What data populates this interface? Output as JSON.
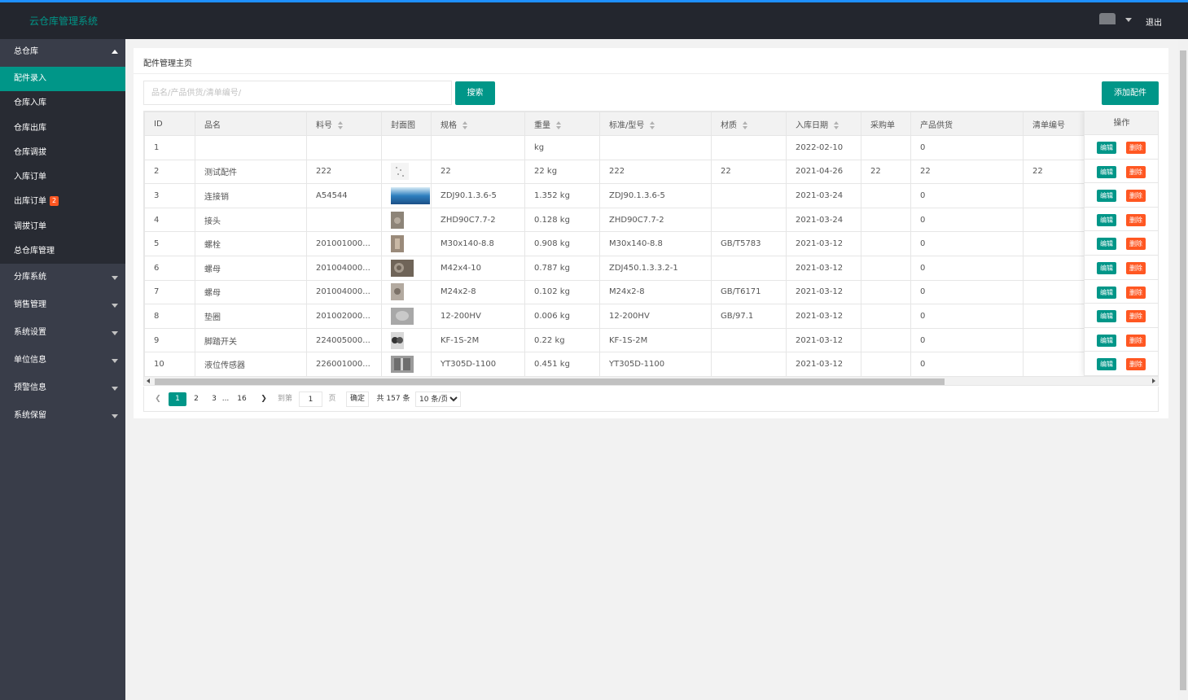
{
  "header": {
    "app_title": "云仓库管理系统",
    "logout_label": "退出"
  },
  "sidebar": {
    "main_group": "总仓库",
    "sub_items": [
      {
        "label": "配件录入",
        "active": true
      },
      {
        "label": "仓库入库"
      },
      {
        "label": "仓库出库"
      },
      {
        "label": "仓库调拔"
      },
      {
        "label": "入库订单"
      },
      {
        "label": "出库订单",
        "badge": "2"
      },
      {
        "label": "调拔订单"
      },
      {
        "label": "总仓库管理"
      }
    ],
    "groups": [
      "分库系统",
      "销售管理",
      "系统设置",
      "单位信息",
      "预警信息",
      "系统保留"
    ]
  },
  "page": {
    "breadcrumb": "配件管理主页",
    "search_placeholder": "品名/产品供货/清单编号/",
    "search_label": "搜索",
    "add_label": "添加配件"
  },
  "table": {
    "columns": [
      "ID",
      "品名",
      "料号",
      "封面图",
      "规格",
      "重量",
      "标准/型号",
      "材质",
      "入库日期",
      "采购单",
      "产品供货",
      "清单编号"
    ],
    "actions_header": "操作",
    "edit_label": "编辑",
    "delete_label": "删除",
    "rows": [
      {
        "id": "1",
        "name": "",
        "part_no": "",
        "spec": "",
        "weight": "kg",
        "standard": "",
        "material": "",
        "date": "2022-02-10",
        "purchase": "",
        "supply": "0",
        "list_no": ""
      },
      {
        "id": "2",
        "name": "测试配件",
        "part_no": "222",
        "spec": "22",
        "weight": "22 kg",
        "standard": "222",
        "material": "22",
        "date": "2021-04-26",
        "purchase": "22",
        "supply": "22",
        "list_no": "22"
      },
      {
        "id": "3",
        "name": "连接销",
        "part_no": "A54544",
        "spec": "ZDJ90.1.3.6-5",
        "weight": "1.352 kg",
        "standard": "ZDJ90.1.3.6-5",
        "material": "",
        "date": "2021-03-24",
        "purchase": "",
        "supply": "0",
        "list_no": ""
      },
      {
        "id": "4",
        "name": "接头",
        "part_no": "",
        "spec": "ZHD90C7.7-2",
        "weight": "0.128 kg",
        "standard": "ZHD90C7.7-2",
        "material": "",
        "date": "2021-03-24",
        "purchase": "",
        "supply": "0",
        "list_no": ""
      },
      {
        "id": "5",
        "name": "螺栓",
        "part_no": "201001000...",
        "spec": "M30x140-8.8",
        "weight": "0.908 kg",
        "standard": "M30x140-8.8",
        "material": "GB/T5783",
        "date": "2021-03-12",
        "purchase": "",
        "supply": "0",
        "list_no": ""
      },
      {
        "id": "6",
        "name": "螺母",
        "part_no": "201004000...",
        "spec": "M42x4-10",
        "weight": "0.787 kg",
        "standard": "ZDJ450.1.3.3.2-1",
        "material": "",
        "date": "2021-03-12",
        "purchase": "",
        "supply": "0",
        "list_no": ""
      },
      {
        "id": "7",
        "name": "螺母",
        "part_no": "201004000...",
        "spec": "M24x2-8",
        "weight": "0.102 kg",
        "standard": "M24x2-8",
        "material": "GB/T6171",
        "date": "2021-03-12",
        "purchase": "",
        "supply": "0",
        "list_no": ""
      },
      {
        "id": "8",
        "name": "垫圈",
        "part_no": "201002000...",
        "spec": "12-200HV",
        "weight": "0.006 kg",
        "standard": "12-200HV",
        "material": "GB/97.1",
        "date": "2021-03-12",
        "purchase": "",
        "supply": "0",
        "list_no": ""
      },
      {
        "id": "9",
        "name": "脚踏开关",
        "part_no": "224005000...",
        "spec": "KF-1S-2M",
        "weight": "0.22 kg",
        "standard": "KF-1S-2M",
        "material": "",
        "date": "2021-03-12",
        "purchase": "",
        "supply": "0",
        "list_no": ""
      },
      {
        "id": "10",
        "name": "液位传感器",
        "part_no": "226001000...",
        "spec": "YT305D-1100",
        "weight": "0.451 kg",
        "standard": "YT305D-1100",
        "material": "",
        "date": "2021-03-12",
        "purchase": "",
        "supply": "0",
        "list_no": ""
      }
    ]
  },
  "pager": {
    "pages": [
      "1",
      "2",
      "3",
      "...",
      "16"
    ],
    "goto_label": "到第",
    "goto_value": "1",
    "page_unit": "页",
    "confirm_label": "确定",
    "total_label": "共 157 条",
    "page_size": "10 条/页"
  }
}
